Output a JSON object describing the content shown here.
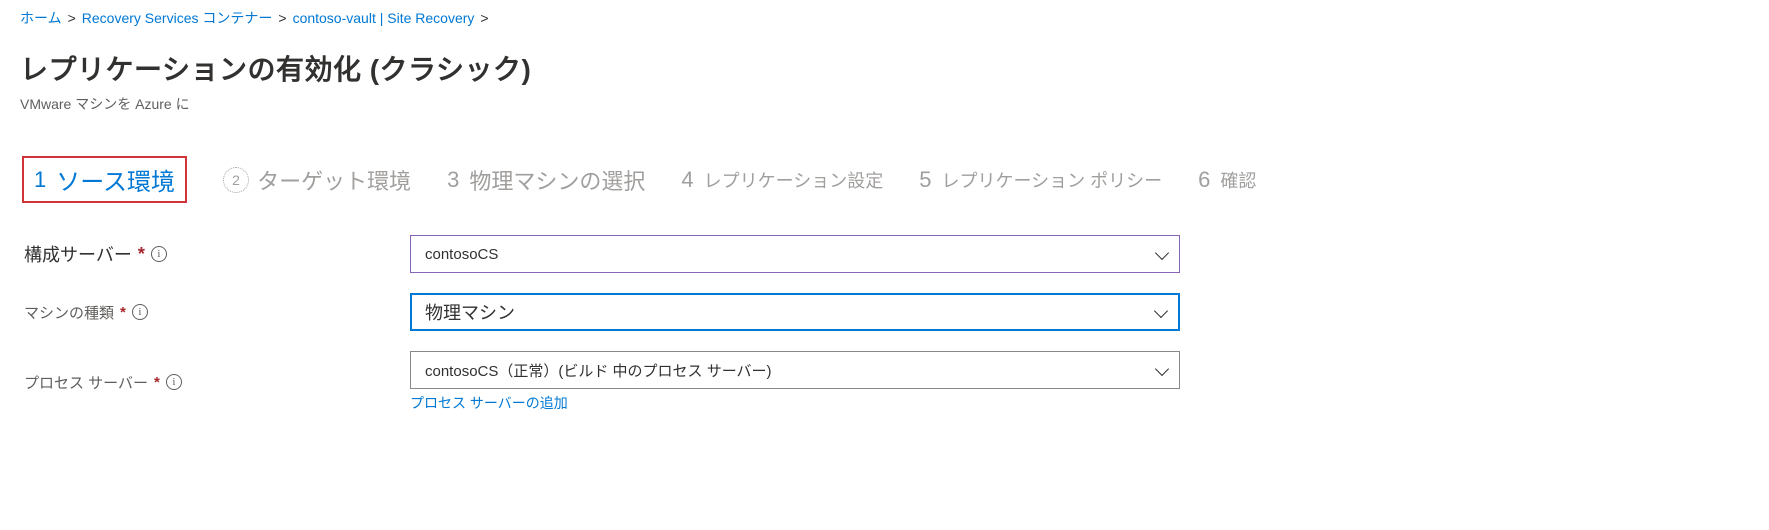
{
  "breadcrumb": {
    "home": "ホーム",
    "sep": ">",
    "vaults": "Recovery Services コンテナー",
    "current": "contoso-vault | Site Recovery"
  },
  "header": {
    "title": "レプリケーションの有効化 (クラシック)",
    "subtitle": "VMware マシンを Azure に"
  },
  "steps": {
    "s1": {
      "num": "1",
      "label": "ソース環境"
    },
    "s2": {
      "num": "2",
      "label": "ターゲット環境"
    },
    "s3": {
      "num": "3",
      "label": "物理マシンの選択"
    },
    "s4": {
      "num": "4",
      "label": "レプリケーション設定"
    },
    "s5": {
      "num": "5",
      "label": "レプリケーション ポリシー"
    },
    "s6": {
      "num": "6",
      "label": "確認"
    }
  },
  "form": {
    "config_server": {
      "label": "構成サーバー",
      "required": "*",
      "value": "contosoCS"
    },
    "machine_type": {
      "label": "マシンの種類",
      "required": "*",
      "value": "物理マシン"
    },
    "process_server": {
      "label": "プロセス サーバー",
      "required": "*",
      "value": "contosoCS（正常）(ビルド 中のプロセス サーバー)",
      "helper": "プロセス サーバーの追加"
    }
  }
}
